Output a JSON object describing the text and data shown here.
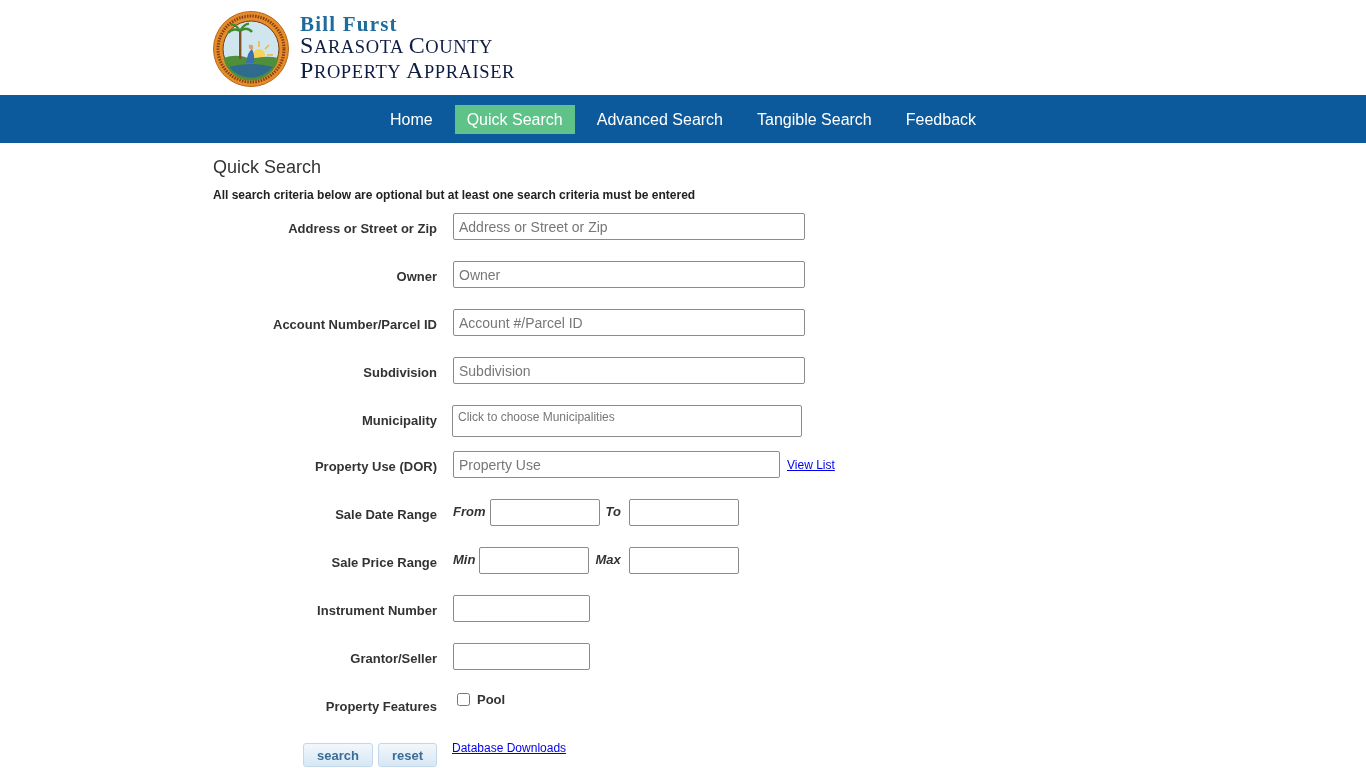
{
  "header": {
    "appraiser_name": "Bill Furst",
    "agency_lines": [
      "SARASOTA COUNTY",
      "PROPERTY APPRAISER"
    ]
  },
  "nav": [
    {
      "label": "Home",
      "selected": false
    },
    {
      "label": "Quick Search",
      "selected": true
    },
    {
      "label": "Advanced Search",
      "selected": false
    },
    {
      "label": "Tangible Search",
      "selected": false
    },
    {
      "label": "Feedback",
      "selected": false
    }
  ],
  "page_title": "Quick Search",
  "intro": "All search criteria below are optional but at least one search criteria must be entered",
  "fields": [
    {
      "kind": "text",
      "label": "Address or Street or Zip",
      "placeholder": "Address or Street or Zip"
    },
    {
      "kind": "text",
      "label": "Owner",
      "placeholder": "Owner"
    },
    {
      "kind": "text",
      "label": "Account Number/Parcel ID",
      "placeholder": "Account #/Parcel ID"
    },
    {
      "kind": "text",
      "label": "Subdivision",
      "placeholder": "Subdivision"
    },
    {
      "kind": "multiselect",
      "label": "Municipality",
      "placeholder": "Click to choose Municipalities"
    },
    {
      "kind": "text_link",
      "label": "Property Use (DOR)",
      "placeholder": "Property Use",
      "link": "View List"
    },
    {
      "kind": "range",
      "label": "Sale Date Range",
      "from_label": "From",
      "to_label": "To"
    },
    {
      "kind": "range",
      "label": "Sale Price Range",
      "from_label": "Min",
      "to_label": "Max"
    },
    {
      "kind": "short",
      "label": "Instrument Number"
    },
    {
      "kind": "short",
      "label": "Grantor/Seller"
    },
    {
      "kind": "checkboxes",
      "label": "Property Features",
      "options": [
        {
          "label": "Pool",
          "checked": false
        }
      ]
    }
  ],
  "buttons": [
    "search",
    "reset"
  ],
  "downloads_link": "Database Downloads"
}
